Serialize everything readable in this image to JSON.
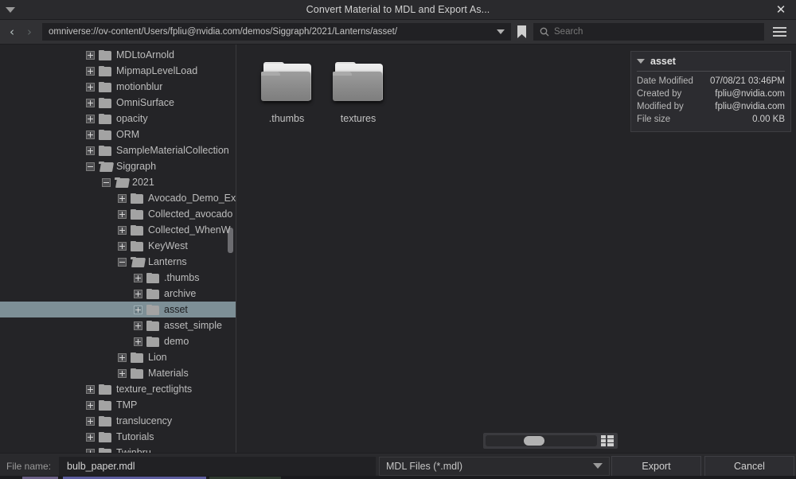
{
  "window": {
    "title": "Convert Material to MDL and Export As...",
    "menu_icon": "triangle-down-icon",
    "close_label": "✕"
  },
  "toolbar": {
    "back_icon": "chevron-left-icon",
    "forward_icon": "chevron-right-icon",
    "path": "omniverse://ov-content/Users/fpliu@nvidia.com/demos/Siggraph/2021/Lanterns/asset/",
    "path_caret_icon": "chevron-down-icon",
    "bookmark_icon": "bookmark-icon",
    "search_icon": "search-icon",
    "search_placeholder": "Search",
    "menu_icon": "hamburger-icon"
  },
  "tree": {
    "items": [
      {
        "label": "MDLtoArnold",
        "indent": 0,
        "state": "collapsed",
        "selected": false
      },
      {
        "label": "MipmapLevelLoad",
        "indent": 0,
        "state": "collapsed",
        "selected": false
      },
      {
        "label": "motionblur",
        "indent": 0,
        "state": "collapsed",
        "selected": false
      },
      {
        "label": "OmniSurface",
        "indent": 0,
        "state": "collapsed",
        "selected": false
      },
      {
        "label": "opacity",
        "indent": 0,
        "state": "collapsed",
        "selected": false
      },
      {
        "label": "ORM",
        "indent": 0,
        "state": "collapsed",
        "selected": false
      },
      {
        "label": "SampleMaterialCollection",
        "indent": 0,
        "state": "collapsed",
        "selected": false
      },
      {
        "label": "Siggraph",
        "indent": 0,
        "state": "expanded",
        "selected": false
      },
      {
        "label": "2021",
        "indent": 1,
        "state": "expanded",
        "selected": false
      },
      {
        "label": "Avocado_Demo_Ex",
        "indent": 2,
        "state": "collapsed",
        "selected": false
      },
      {
        "label": "Collected_avocado",
        "indent": 2,
        "state": "collapsed",
        "selected": false
      },
      {
        "label": "Collected_WhenW",
        "indent": 2,
        "state": "collapsed",
        "selected": false
      },
      {
        "label": "KeyWest",
        "indent": 2,
        "state": "collapsed",
        "selected": false
      },
      {
        "label": "Lanterns",
        "indent": 2,
        "state": "expanded",
        "selected": false
      },
      {
        "label": ".thumbs",
        "indent": 3,
        "state": "collapsed",
        "selected": false
      },
      {
        "label": "archive",
        "indent": 3,
        "state": "collapsed",
        "selected": false
      },
      {
        "label": "asset",
        "indent": 3,
        "state": "collapsed",
        "selected": true
      },
      {
        "label": "asset_simple",
        "indent": 3,
        "state": "collapsed",
        "selected": false
      },
      {
        "label": "demo",
        "indent": 3,
        "state": "collapsed",
        "selected": false
      },
      {
        "label": "Lion",
        "indent": 2,
        "state": "collapsed",
        "selected": false
      },
      {
        "label": "Materials",
        "indent": 2,
        "state": "collapsed",
        "selected": false
      },
      {
        "label": "texture_rectlights",
        "indent": 0,
        "state": "collapsed",
        "selected": false
      },
      {
        "label": "TMP",
        "indent": 0,
        "state": "collapsed",
        "selected": false
      },
      {
        "label": "translucency",
        "indent": 0,
        "state": "collapsed",
        "selected": false
      },
      {
        "label": "Tutorials",
        "indent": 0,
        "state": "collapsed",
        "selected": false
      },
      {
        "label": "Twinbru",
        "indent": 0,
        "state": "collapsed",
        "selected": false
      }
    ]
  },
  "content": {
    "items": [
      {
        "label": ".thumbs",
        "icon": "folder-icon"
      },
      {
        "label": "textures",
        "icon": "folder-icon"
      }
    ],
    "zoom_slider_percent": 42,
    "view_toggle_icon": "grid-view-icon"
  },
  "info": {
    "title": "asset",
    "collapse_icon": "triangle-down-icon",
    "rows": [
      {
        "key": "Date Modified",
        "value": "07/08/21 03:46PM"
      },
      {
        "key": "Created by",
        "value": "fpliu@nvidia.com"
      },
      {
        "key": "Modified by",
        "value": "fpliu@nvidia.com"
      },
      {
        "key": "File size",
        "value": "0.00 KB"
      }
    ]
  },
  "footer": {
    "filename_label": "File name:",
    "filename_value": "bulb_paper.mdl",
    "filter_value": "MDL Files (*.mdl)",
    "filter_caret_icon": "chevron-down-icon",
    "export_label": "Export",
    "cancel_label": "Cancel"
  }
}
